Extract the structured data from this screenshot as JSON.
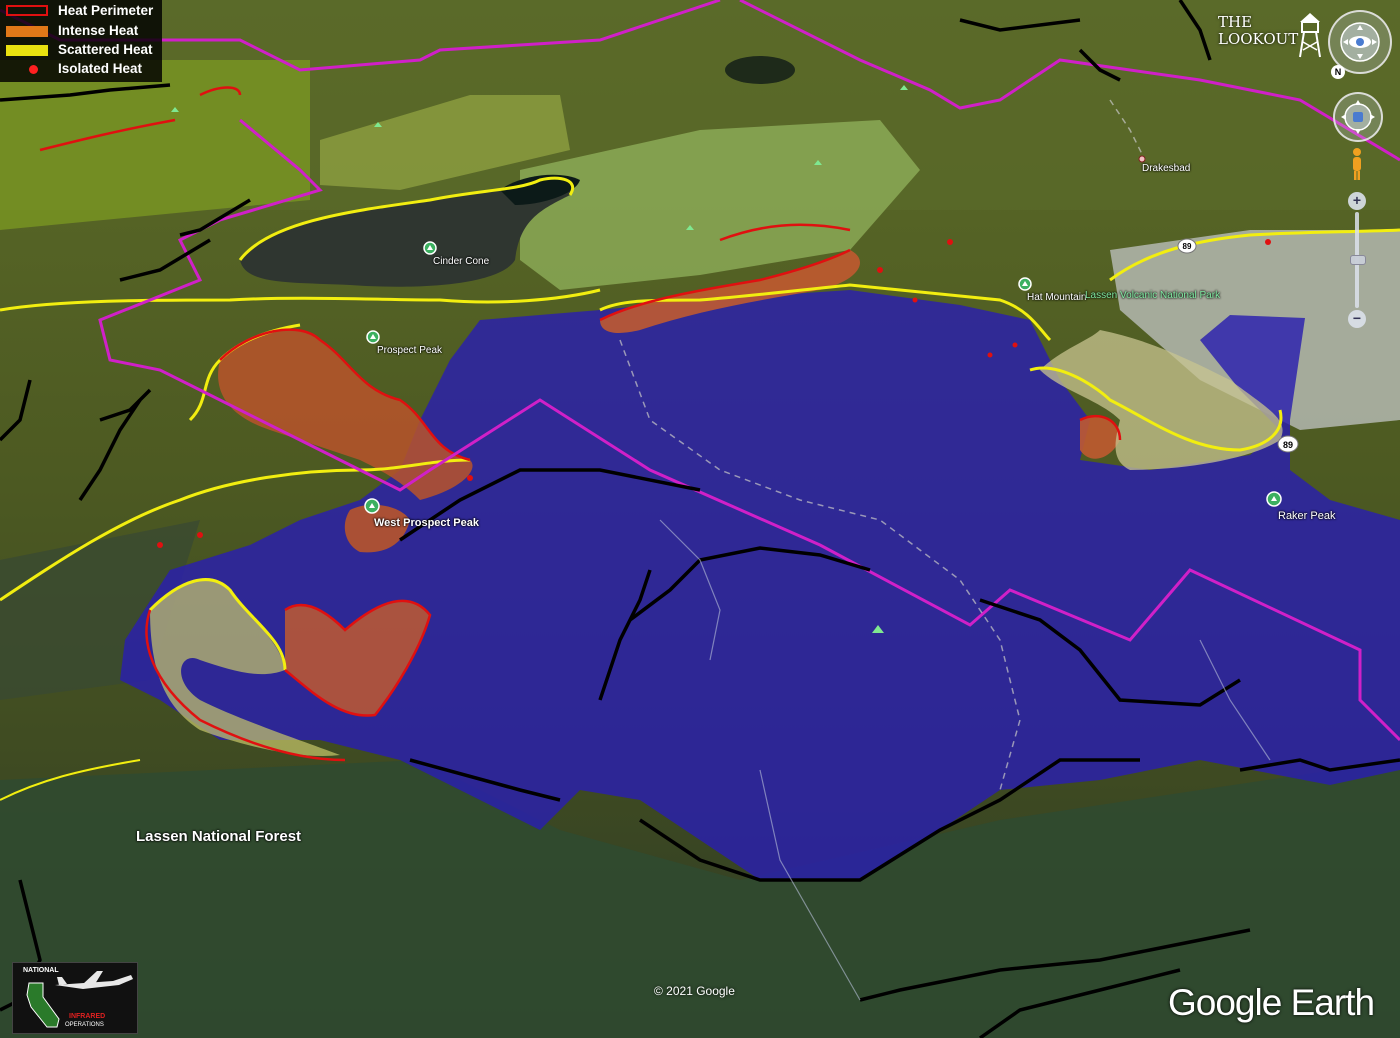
{
  "legend": {
    "items": [
      {
        "label": "Heat Perimeter",
        "color": "#e01010",
        "style": "outline"
      },
      {
        "label": "Intense Heat",
        "color": "#e07818",
        "style": "fill"
      },
      {
        "label": "Scattered Heat",
        "color": "#e8e010",
        "style": "fill"
      },
      {
        "label": "Isolated Heat",
        "color": "#ff2020",
        "style": "dot"
      }
    ]
  },
  "places": {
    "cinder_cone": "Cinder Cone",
    "prospect_peak": "Prospect Peak",
    "west_prospect_peak": "West Prospect Peak",
    "hat_mountain": "Hat Mountain",
    "lassen_park": "Lassen Volcanic National Park",
    "drakesbad": "Drakesbad",
    "raker_peak": "Raker Peak",
    "lassen_forest": "Lassen National Forest",
    "route_89_a": "89",
    "route_89_b": "89"
  },
  "branding": {
    "lookout_logo": "THE LOOKOUT",
    "nio_logo_top": "NATIONAL",
    "nio_logo_middle": "INFRARED",
    "nio_logo_bottom": "OPERATIONS",
    "copyright": "© 2021 Google",
    "google_earth": "Google Earth"
  },
  "controls": {
    "compass_north": "N",
    "zoom_in": "+",
    "zoom_out": "−"
  },
  "colors": {
    "burned_area": "#2a1fae",
    "heat_perimeter": "#e01010",
    "intense_heat": "#d06020",
    "scattered_heat": "#e8e010",
    "park_boundary": "#d020c8",
    "roads": "#000000"
  }
}
